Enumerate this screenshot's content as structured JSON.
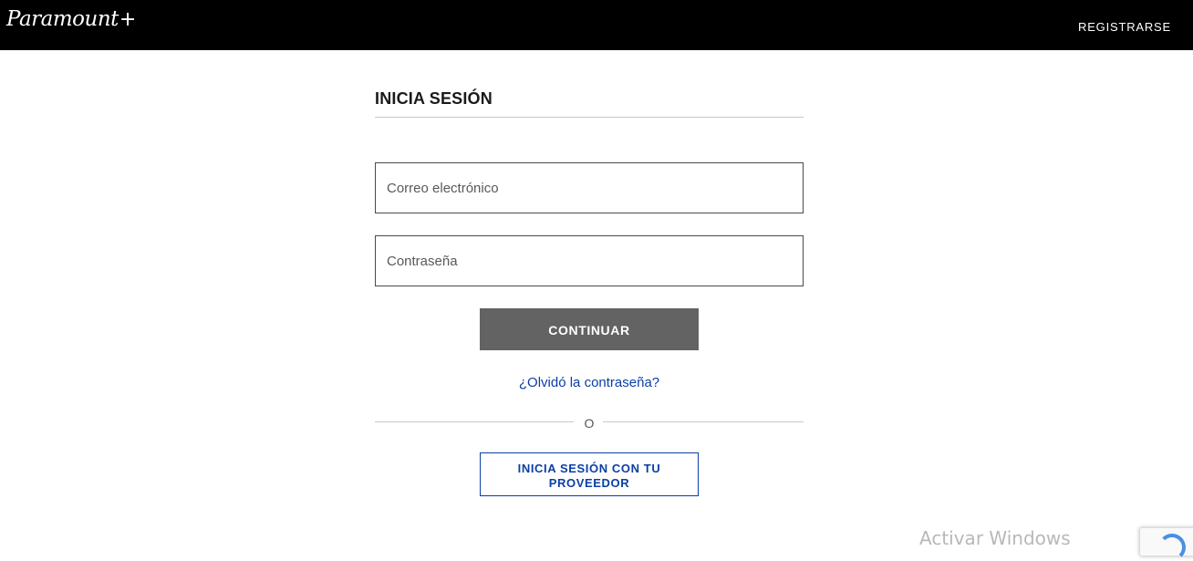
{
  "header": {
    "logo_text": "Paramount",
    "logo_plus": "+",
    "register_label": "REGISTRARSE"
  },
  "login": {
    "title": "INICIA SESIÓN",
    "email_placeholder": "Correo electrónico",
    "password_placeholder": "Contraseña",
    "continue_label": "CONTINUAR",
    "forgot_label": "¿Olvidó la contraseña?",
    "or_label": "O",
    "provider_label": "INICIA SESIÓN CON TU PROVEEDOR"
  },
  "overlay": {
    "watermark_text": "Activar Windows",
    "recaptcha_icon": "recaptcha-icon"
  },
  "colors": {
    "header_bg": "#000000",
    "continue_bg": "#636363",
    "link_blue": "#0b3fa4"
  }
}
